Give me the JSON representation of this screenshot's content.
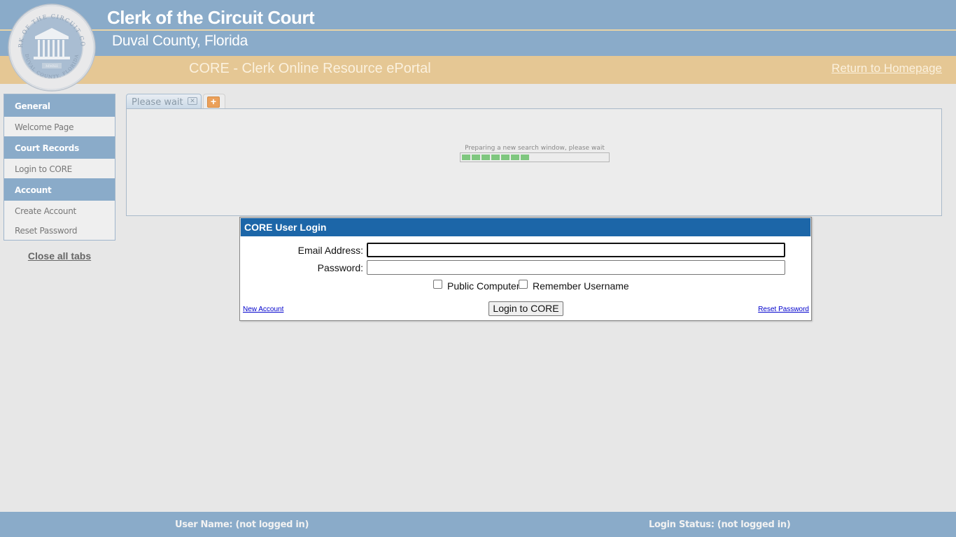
{
  "header": {
    "title": "Clerk of the Circuit Court",
    "subtitle": "Duval County, Florida",
    "portal_title": "CORE - Clerk Online Resource ePortal",
    "home_link": "Return to Homepage",
    "seal": {
      "top_text": "CLERK OF THE CIRCUIT COURT",
      "bottom_text": "DUVAL COUNTY, FLORIDA",
      "year": "MMXII"
    }
  },
  "sidebar": {
    "sections": [
      {
        "heading": "General",
        "items": [
          "Welcome Page"
        ]
      },
      {
        "heading": "Court Records",
        "items": [
          "Login to CORE"
        ]
      },
      {
        "heading": "Account",
        "items": [
          "Create Account",
          "Reset Password"
        ]
      }
    ],
    "close_all": "Close all tabs"
  },
  "tabs": {
    "items": [
      {
        "label": "Please wait",
        "close_icon": "close-icon"
      }
    ],
    "add_icon": "plus-icon"
  },
  "panel": {
    "status_text": "Preparing a new search window, please wait",
    "progress_segments_filled": 7,
    "progress_color": "#7fc77f"
  },
  "login": {
    "title": "CORE User Login",
    "email_label": "Email Address:",
    "email_value": "",
    "password_label": "Password:",
    "password_value": "",
    "public_computer_label": "Public Computer",
    "public_computer_checked": false,
    "remember_label": "Remember Username",
    "remember_checked": false,
    "new_account_link": "New Account",
    "submit_label": "Login to CORE",
    "reset_password_link": "Reset Password",
    "title_color": "#1c66a8"
  },
  "footer": {
    "user_name": "User Name: (not logged in)",
    "login_status": "Login Status: (not logged in)"
  },
  "colors": {
    "header_blue": "#8aabc9",
    "header_tan": "#e5c794",
    "background": "#e7e7e7"
  }
}
